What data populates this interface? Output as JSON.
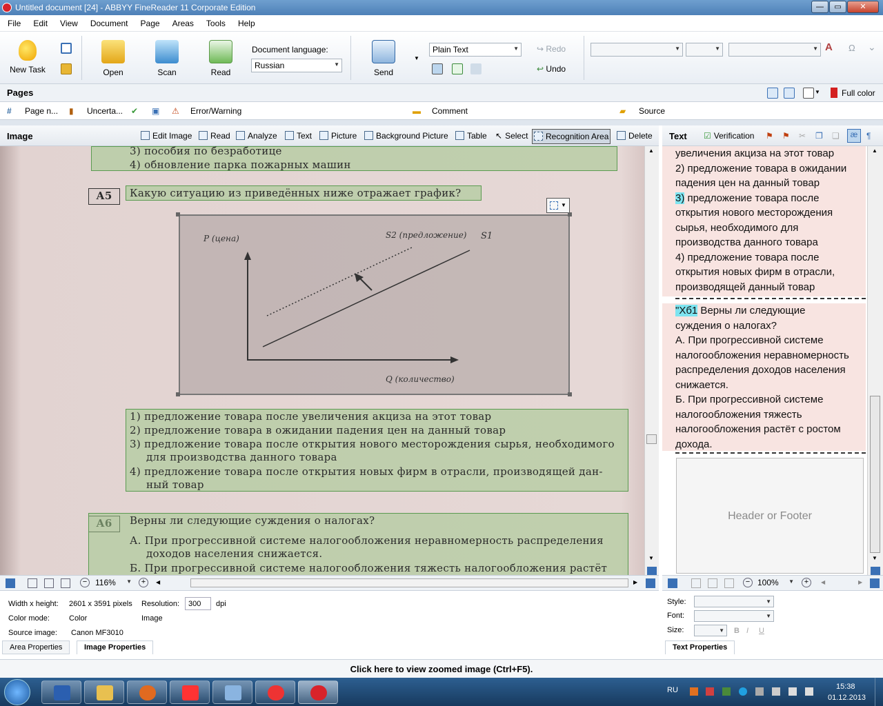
{
  "window": {
    "title": "Untitled document [24] - ABBYY FineReader 11 Corporate Edition",
    "min": "—",
    "max": "▭",
    "close": "✕"
  },
  "menu": [
    "File",
    "Edit",
    "View",
    "Document",
    "Page",
    "Areas",
    "Tools",
    "Help"
  ],
  "toolbar": {
    "new_task": "New Task",
    "open": "Open",
    "scan": "Scan",
    "read": "Read",
    "doc_lang_label": "Document language:",
    "doc_lang_value": "Russian",
    "send": "Send",
    "format_value": "Plain Text",
    "redo": "Redo",
    "undo": "Undo"
  },
  "pages": {
    "title": "Pages",
    "full_color": "Full color",
    "col_page": "Page n...",
    "col_uncertain": "Uncerta...",
    "col_error": "Error/Warning",
    "col_comment": "Comment",
    "col_source": "Source"
  },
  "image_panel": {
    "title": "Image",
    "tools": [
      "Edit Image",
      "Read",
      "Analyze",
      "Text",
      "Picture",
      "Background Picture",
      "Table",
      "Select",
      "Recognition Area",
      "Delete"
    ]
  },
  "scan": {
    "prev_items": [
      "3)  пособия  по  безработице",
      "4)  обновление  парка  пожарных  машин"
    ],
    "a5_label": "А5",
    "a5_question": "Какую ситуацию из приведённых ниже отражает график?",
    "a5_options": [
      "1)  предложение  товара  после  увеличения  акциза  на  этот  товар",
      "2)  предложение  товара  в  ожидании  падения  цен  на  данный  товар",
      "3)  предложение  товара  после  открытия  нового  месторождения  сырья,  необходимого",
      "для  производства  данного  товара",
      "4)  предложение  товара  после  открытия  новых  фирм  в  отрасли,  производящей  дан-",
      "ный  товар"
    ],
    "a6_label": "А6",
    "a6_question": "Верны ли следующие суждения о налогах?",
    "a6_lines": [
      "А.  При  прогрессивной  системе  налогообложения  неравномерность  распределения",
      "доходов  населения  снижается.",
      "Б.  При  прогрессивной  системе  налогообложения  тяжесть  налогообложения  растёт"
    ]
  },
  "graph": {
    "y_label": "P (цена)",
    "x_label": "Q (количество)",
    "s2_label": "S2 (предложение)",
    "s1_label": "S1"
  },
  "text_panel": {
    "title": "Text",
    "verification": "Verification",
    "block1": [
      "увеличения акциза на этот товар",
      "2) предложение товара в ожидании",
      "падения цен на данный товар"
    ],
    "block1_hl": "3)",
    "block1_hl_rest": " предложение товара после",
    "block1b": [
      "открытия нового месторождения",
      "сырья, необходимого для",
      "производства данного товара",
      "4) предложение товара после",
      "открытия новых фирм в отрасли,",
      "производящей данный товар"
    ],
    "block2_hl": "\"Хб1",
    "block2_hl_rest": " Верны ли следующие",
    "block2": [
      "суждения о налогах?",
      "А. При прогрессивной системе",
      "налогообложения неравномерность",
      "распределения доходов населения",
      "снижается.",
      "Б. При прогрессивной системе",
      "налогообложения тяжесть",
      "налогообложения растёт с ростом",
      "дохода."
    ],
    "header_footer": "Header or Footer"
  },
  "zoom": {
    "image": "116%",
    "text": "100%"
  },
  "props": {
    "wh_label": "Width x height:",
    "wh_value": "2601 x 3591 pixels",
    "res_label": "Resolution:",
    "res_value": "300",
    "res_unit": "dpi",
    "cm_label": "Color mode:",
    "cm_value": "Color",
    "image_label": "Image",
    "src_label": "Source image:",
    "src_value": "Canon MF3010",
    "tab_area": "Area Properties",
    "tab_image": "Image Properties"
  },
  "tprops": {
    "style": "Style:",
    "font": "Font:",
    "size": "Size:",
    "tab": "Text Properties"
  },
  "zoom_hint": "Click here to view zoomed image (Ctrl+F5).",
  "tray": {
    "lang": "RU",
    "time": "15:38",
    "date": "01.12.2013"
  }
}
